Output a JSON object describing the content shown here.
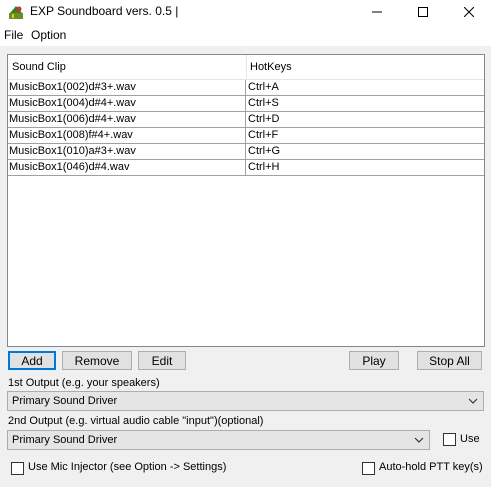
{
  "window": {
    "title": "EXP Soundboard vers. 0.5 |",
    "app_icon": "soundboard-app-icon",
    "controls": [
      "minimize-icon",
      "maximize-icon",
      "close-icon"
    ]
  },
  "menu": {
    "items": [
      "File",
      "Option"
    ]
  },
  "list": {
    "columns": [
      "Sound Clip",
      "HotKeys"
    ],
    "rows": [
      {
        "clip": "MusicBox1(002)d#3+.wav",
        "hotkey": "Ctrl+A"
      },
      {
        "clip": "MusicBox1(004)d#4+.wav",
        "hotkey": "Ctrl+S"
      },
      {
        "clip": "MusicBox1(006)d#4+.wav",
        "hotkey": "Ctrl+D"
      },
      {
        "clip": "MusicBox1(008)f#4+.wav",
        "hotkey": "Ctrl+F"
      },
      {
        "clip": "MusicBox1(010)a#3+.wav",
        "hotkey": "Ctrl+G"
      },
      {
        "clip": "MusicBox1(046)d#4.wav",
        "hotkey": "Ctrl+H"
      }
    ]
  },
  "buttons": {
    "add": "Add",
    "remove": "Remove",
    "edit": "Edit",
    "play": "Play",
    "stop_all": "Stop All"
  },
  "output1": {
    "label": "1st Output (e.g. your speakers)",
    "selected": "Primary Sound Driver"
  },
  "output2": {
    "label": "2nd Output (e.g. virtual audio cable \"input\")(optional)",
    "selected": "Primary Sound Driver",
    "use_label": "Use",
    "use_checked": false
  },
  "options": {
    "mic_injector_label": "Use Mic Injector (see Option -> Settings)",
    "mic_injector_checked": false,
    "auto_ptt_label": "Auto-hold PTT key(s)",
    "auto_ptt_checked": false
  },
  "colors": {
    "focus_border": "#0078d7",
    "window_bg": "#f0f0f0"
  }
}
